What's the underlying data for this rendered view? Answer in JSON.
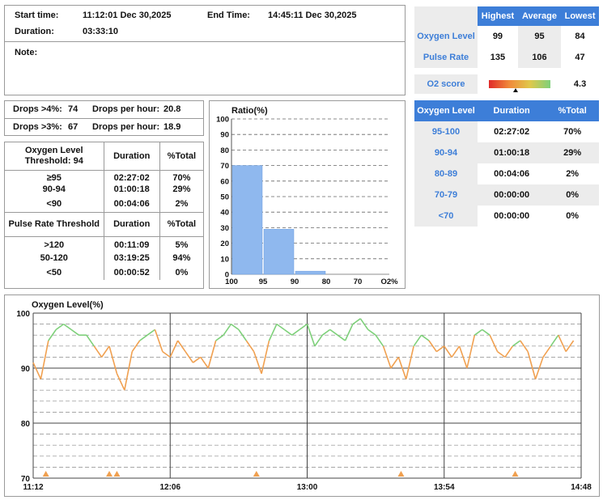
{
  "session": {
    "start_label": "Start time:",
    "start_value": "11:12:01 Dec 30,2025",
    "end_label": "End Time:",
    "end_value": "14:45:11 Dec 30,2025",
    "duration_label": "Duration:",
    "duration_value": "03:33:10",
    "note_label": "Note:"
  },
  "summary": {
    "headers": [
      "Highest",
      "Average",
      "Lowest"
    ],
    "rows": [
      {
        "label": "Oxygen Level",
        "values": [
          "99",
          "95",
          "84"
        ]
      },
      {
        "label": "Pulse Rate",
        "values": [
          "135",
          "106",
          "47"
        ]
      }
    ],
    "o2_score_label": "O2 score",
    "o2_score_value": "4.3"
  },
  "o2_table": {
    "headers": [
      "Oxygen Level",
      "Duration",
      "%Total"
    ],
    "rows": [
      [
        "95-100",
        "02:27:02",
        "70%"
      ],
      [
        "90-94",
        "01:00:18",
        "29%"
      ],
      [
        "80-89",
        "00:04:06",
        "2%"
      ],
      [
        "70-79",
        "00:00:00",
        "0%"
      ],
      [
        "<70",
        "00:00:00",
        "0%"
      ]
    ]
  },
  "drops": {
    "d4_label": "Drops >4%:",
    "d4_value": "74",
    "d4_hour_label": "Drops per hour:",
    "d4_hour_value": "20.8",
    "d3_label": "Drops >3%:",
    "d3_value": "67",
    "d3_hour_label": "Drops per hour:",
    "d3_hour_value": "18.9"
  },
  "threshold": {
    "o2_header_line1": "Oxygen Level",
    "o2_header_line2": "Threshold: 94",
    "duration_header": "Duration",
    "pct_header": "%Total",
    "o2_rows": [
      [
        "≥95",
        "02:27:02",
        "70%"
      ],
      [
        "90-94",
        "01:00:18",
        "29%"
      ],
      [
        "<90",
        "00:04:06",
        "2%"
      ]
    ],
    "pulse_header": "Pulse Rate Threshold",
    "pulse_rows": [
      [
        ">120",
        "00:11:09",
        "5%"
      ],
      [
        "50-120",
        "03:19:25",
        "94%"
      ],
      [
        "<50",
        "00:00:52",
        "0%"
      ]
    ]
  },
  "colors": {
    "accent": "#3d7ed8",
    "bar": "#8fb8ee",
    "good": "#7ed07a",
    "low": "#f0a050",
    "event": "#f0a050"
  },
  "chart_data": [
    {
      "type": "bar",
      "title": "Ratio(%)",
      "categories": [
        "100-95",
        "95-90",
        "90-80",
        "80-70",
        "70-O2%"
      ],
      "x_tick_labels": [
        "100",
        "95",
        "90",
        "80",
        "70",
        "O2%"
      ],
      "values": [
        70,
        29,
        2,
        0,
        0
      ],
      "ylim": [
        0,
        100
      ],
      "y_ticks": [
        0,
        10,
        20,
        30,
        40,
        50,
        60,
        70,
        80,
        90,
        100
      ],
      "grid": true
    },
    {
      "type": "line",
      "title": "Oxygen Level(%)",
      "x_ticks": [
        "11:12",
        "12:06",
        "13:00",
        "13:54",
        "14:48"
      ],
      "y_ticks": [
        70,
        80,
        90,
        100
      ],
      "ylim": [
        70,
        100
      ],
      "threshold_good": 94,
      "x_minutes": [
        0,
        3,
        6,
        9,
        12,
        15,
        18,
        21,
        24,
        27,
        30,
        33,
        36,
        39,
        42,
        45,
        48,
        51,
        54,
        57,
        60,
        63,
        66,
        69,
        72,
        75,
        78,
        81,
        84,
        87,
        90,
        93,
        96,
        99,
        102,
        105,
        108,
        111,
        114,
        117,
        120,
        123,
        126,
        129,
        132,
        135,
        138,
        141,
        144,
        147,
        150,
        153,
        156,
        159,
        162,
        165,
        168,
        171,
        174,
        177,
        180,
        183,
        186,
        189,
        192,
        195,
        198,
        201,
        204,
        207,
        210,
        213
      ],
      "values": [
        91,
        88,
        95,
        97,
        98,
        97,
        96,
        96,
        94,
        92,
        94,
        89,
        86,
        93,
        95,
        96,
        97,
        93,
        92,
        95,
        93,
        91,
        92,
        90,
        95,
        96,
        98,
        97,
        95,
        93,
        89,
        95,
        98,
        97,
        96,
        97,
        98,
        94,
        96,
        97,
        96,
        95,
        98,
        99,
        97,
        96,
        94,
        90,
        92,
        88,
        94,
        96,
        95,
        93,
        94,
        92,
        94,
        90,
        96,
        97,
        96,
        93,
        92,
        94,
        95,
        93,
        88,
        92,
        94,
        96,
        93,
        95
      ],
      "events_minutes": [
        5,
        30,
        33,
        88,
        145,
        190
      ]
    }
  ]
}
